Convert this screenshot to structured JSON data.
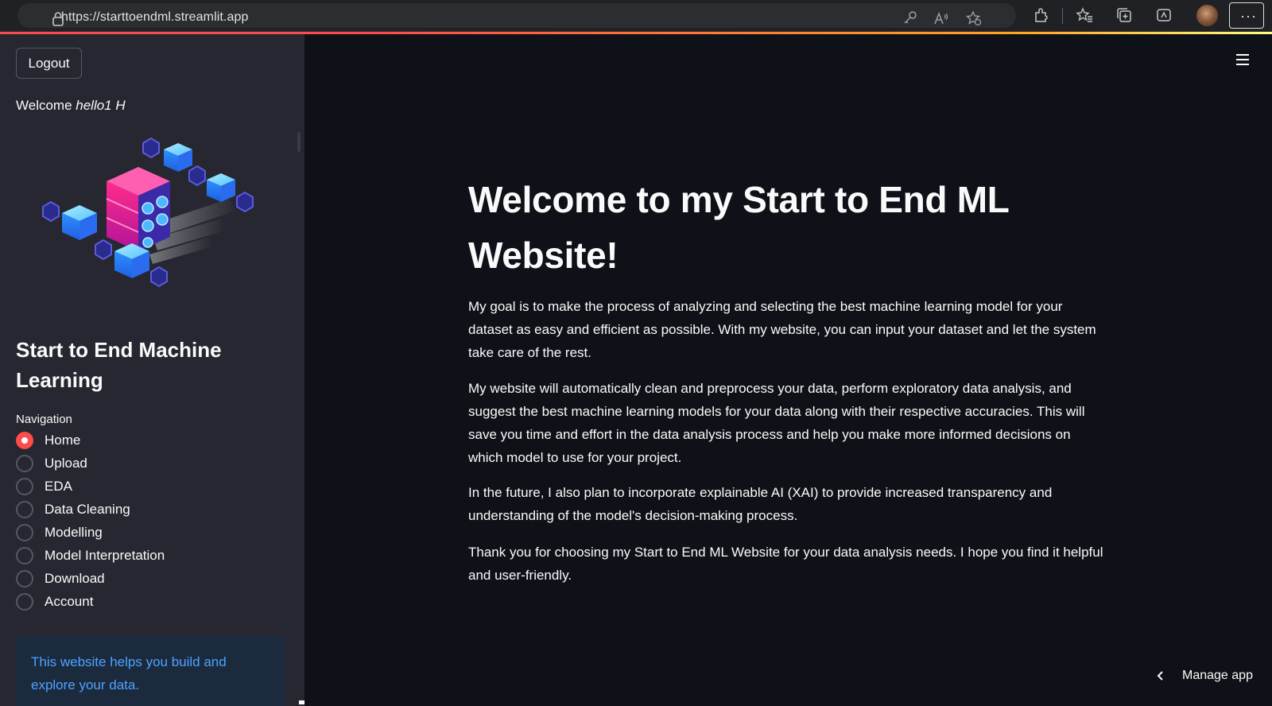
{
  "browser": {
    "url": "https://starttoendml.streamlit.app",
    "icons": [
      "lock-icon",
      "key-icon",
      "read-aloud-icon",
      "favorite-add-icon",
      "extensions-icon",
      "favorites-icon",
      "collections-icon",
      "browser-essentials-icon",
      "profile-avatar",
      "more-icon"
    ],
    "more_label": "···"
  },
  "sidebar": {
    "logout_label": "Logout",
    "welcome_prefix": "Welcome ",
    "welcome_user": "hello1 H",
    "title": "Start to End Machine Learning",
    "nav_label": "Navigation",
    "nav_items": [
      {
        "label": "Home",
        "selected": true
      },
      {
        "label": "Upload",
        "selected": false
      },
      {
        "label": "EDA",
        "selected": false
      },
      {
        "label": "Data Cleaning",
        "selected": false
      },
      {
        "label": "Modelling",
        "selected": false
      },
      {
        "label": "Model Interpretation",
        "selected": false
      },
      {
        "label": "Download",
        "selected": false
      },
      {
        "label": "Account",
        "selected": false
      }
    ],
    "info_text": "This website helps you build and explore your data."
  },
  "main": {
    "title": "Welcome to my Start to End ML Website!",
    "paragraphs": [
      "My goal is to make the process of analyzing and selecting the best machine learning model for your dataset as easy and efficient as possible. With my website, you can input your dataset and let the system take care of the rest.",
      "My website will automatically clean and preprocess your data, perform exploratory data analysis, and suggest the best machine learning models for your data along with their respective accuracies. This will save you time and effort in the data analysis process and help you make more informed decisions on which model to use for your project.",
      "In the future, I also plan to incorporate explainable AI (XAI) to provide increased transparency and understanding of the model's decision-making process.",
      "Thank you for choosing my Start to End ML Website for your data analysis needs. I hope you find it helpful and user-friendly."
    ],
    "manage_app_label": "Manage app"
  },
  "colors": {
    "accent": "#ff4b4b",
    "sidebar_bg": "#262730",
    "main_bg": "#0e1117",
    "info_text": "#4da3ff",
    "info_bg": "#1c2a3e"
  }
}
